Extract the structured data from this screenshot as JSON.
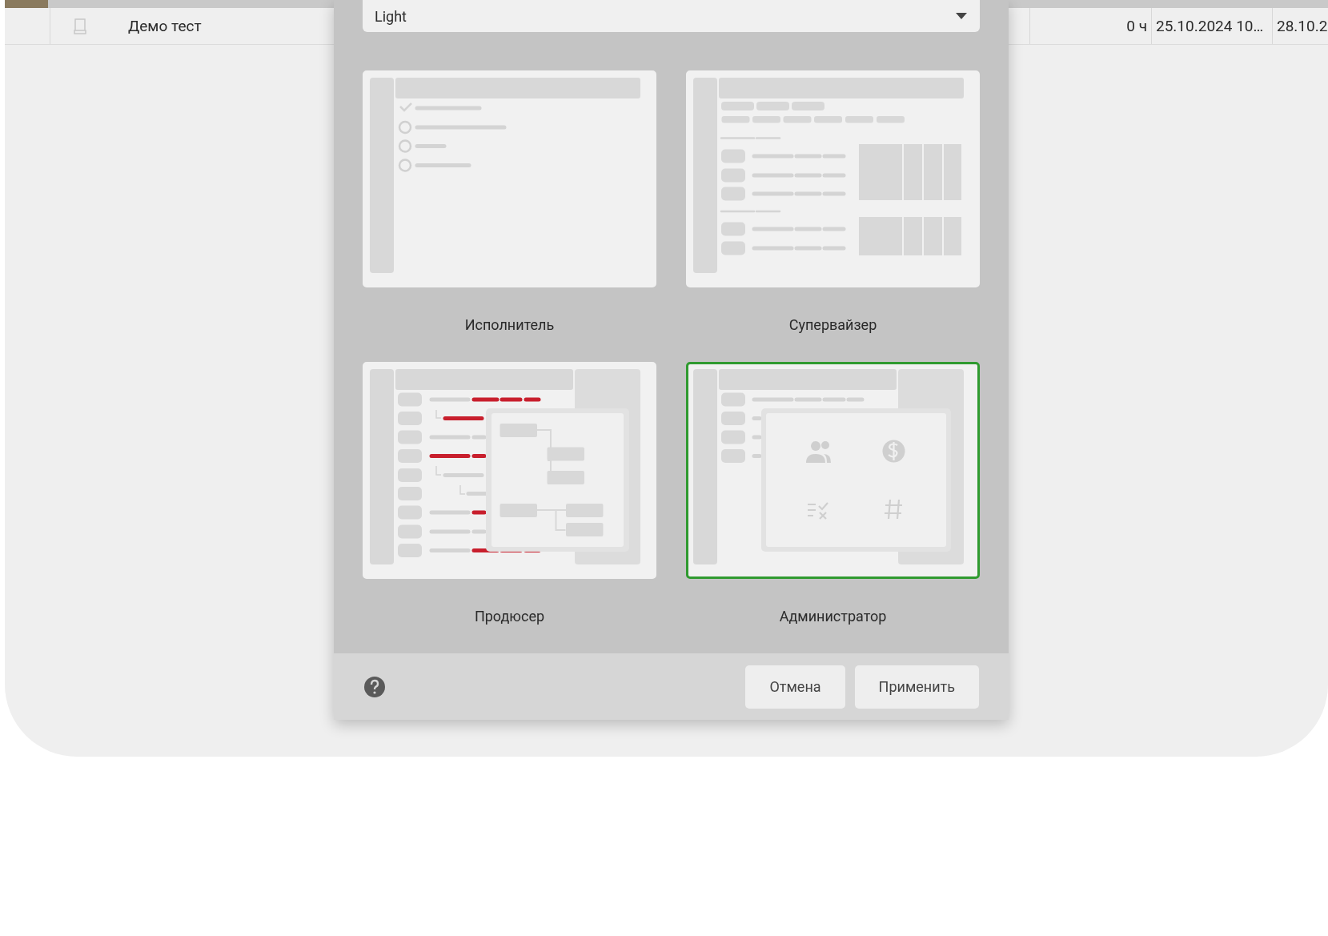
{
  "table": {
    "rows": [
      {
        "cells": [
          "Демо тест",
          "0 ч",
          "25.10.2024 10…",
          "28.10.2"
        ]
      }
    ]
  },
  "dialog": {
    "select": {
      "value": "Light"
    },
    "layouts": [
      {
        "kind": "executor",
        "label": "Исполнитель",
        "selected": false
      },
      {
        "kind": "supervisor",
        "label": "Супервайзер",
        "selected": false
      },
      {
        "kind": "producer",
        "label": "Продюсер",
        "selected": false
      },
      {
        "kind": "admin",
        "label": "Администратор",
        "selected": true
      }
    ],
    "buttons": [
      "Отмена",
      "Применить"
    ]
  }
}
